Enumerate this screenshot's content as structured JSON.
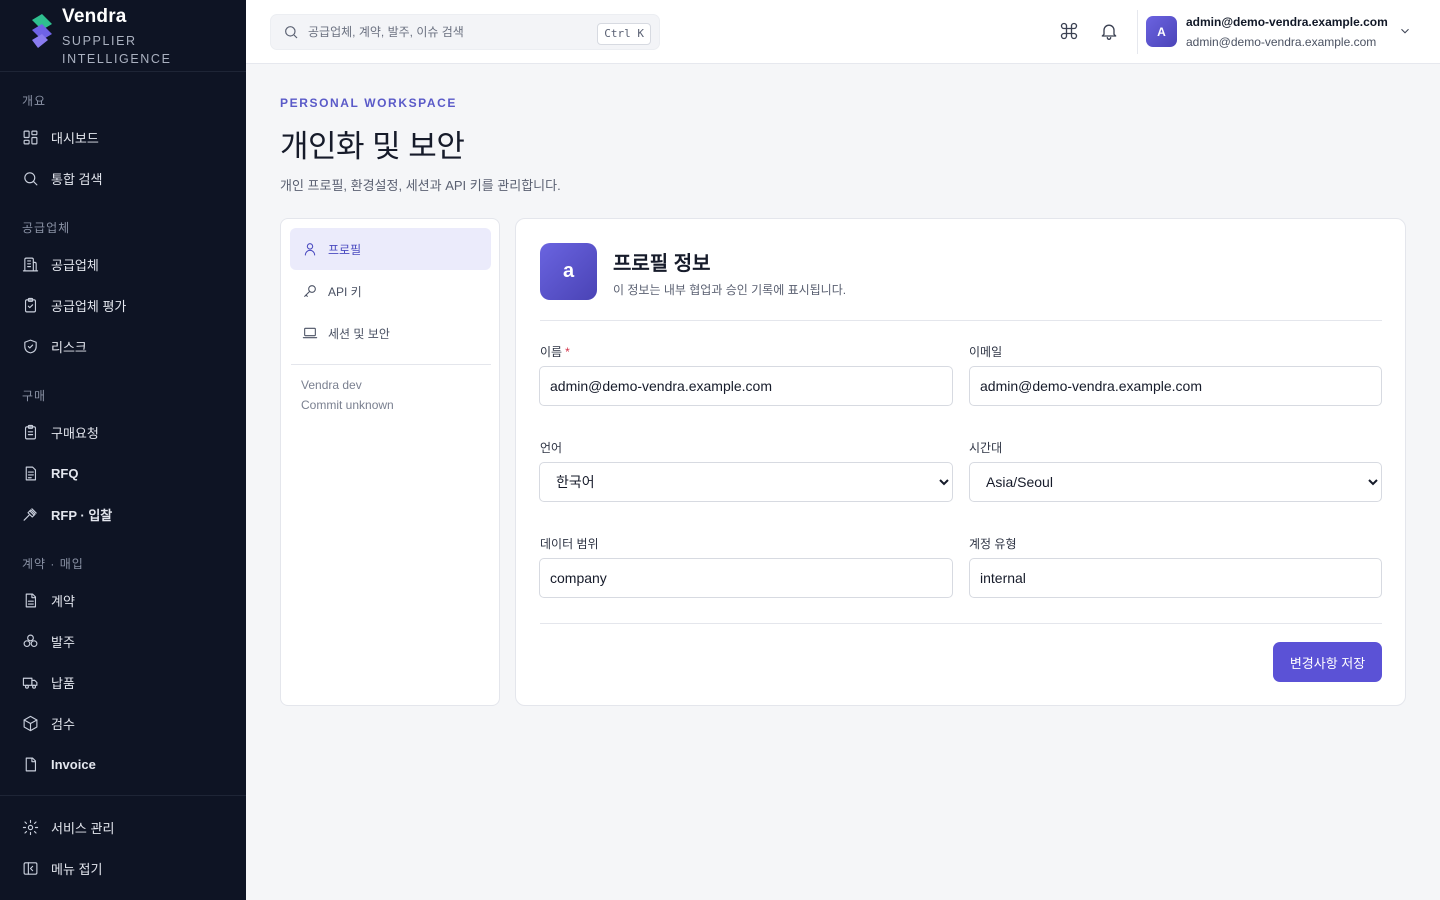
{
  "brand": {
    "name": "Vendra",
    "subtitle": "SUPPLIER INTELLIGENCE"
  },
  "sidebar": {
    "sections": [
      {
        "label": "개요"
      },
      {
        "label": "공급업체"
      },
      {
        "label": "구매"
      },
      {
        "label": "계약 · 매입"
      }
    ],
    "items": [
      {
        "label": "대시보드",
        "icon": "dashboard-icon"
      },
      {
        "label": "통합 검색",
        "icon": "search-icon"
      },
      {
        "label": "공급업체",
        "icon": "building-icon"
      },
      {
        "label": "공급업체 평가",
        "icon": "clipboard-check-icon"
      },
      {
        "label": "리스크",
        "icon": "shield-check-icon"
      },
      {
        "label": "구매요청",
        "icon": "clipboard-list-icon"
      },
      {
        "label": "RFQ",
        "icon": "document-list-icon"
      },
      {
        "label": "RFP · 입찰",
        "icon": "gavel-icon"
      },
      {
        "label": "계약",
        "icon": "document-icon"
      },
      {
        "label": "발주",
        "icon": "boxes-icon"
      },
      {
        "label": "납품",
        "icon": "truck-icon"
      },
      {
        "label": "검수",
        "icon": "package-icon"
      },
      {
        "label": "Invoice",
        "icon": "invoice-icon"
      }
    ],
    "footer": [
      {
        "label": "서비스 관리",
        "icon": "gear-icon"
      },
      {
        "label": "메뉴 접기",
        "icon": "collapse-sidebar-icon"
      }
    ]
  },
  "topbar": {
    "search_placeholder": "공급업체, 계약, 발주, 이슈 검색",
    "search_shortcut": "Ctrl K",
    "user": {
      "initial": "A",
      "name": "admin@demo-vendra.example.com",
      "email": "admin@demo-vendra.example.com"
    }
  },
  "page": {
    "eyebrow": "PERSONAL WORKSPACE",
    "title": "개인화 및 보안",
    "description": "개인 프로필, 환경설정, 세션과 API 키를 관리합니다."
  },
  "settings_nav": {
    "items": [
      {
        "label": "프로필",
        "icon": "user-icon",
        "active": true
      },
      {
        "label": "API 키",
        "icon": "key-icon",
        "active": false
      },
      {
        "label": "세션 및 보안",
        "icon": "laptop-icon",
        "active": false
      }
    ],
    "meta": {
      "version": "Vendra dev",
      "commit": "Commit unknown"
    }
  },
  "profile": {
    "avatar_initial": "a",
    "title": "프로필 정보",
    "subtitle": "이 정보는 내부 협업과 승인 기록에 표시됩니다.",
    "fields": {
      "name": {
        "label": "이름",
        "required_mark": "*",
        "value": "admin@demo-vendra.example.com"
      },
      "email": {
        "label": "이메일",
        "value": "admin@demo-vendra.example.com"
      },
      "language": {
        "label": "언어",
        "value": "한국어"
      },
      "timezone": {
        "label": "시간대",
        "value": "Asia/Seoul"
      },
      "data_scope": {
        "label": "데이터 범위",
        "value": "company"
      },
      "account_type": {
        "label": "계정 유형",
        "value": "internal"
      }
    },
    "save_label": "변경사항 저장"
  },
  "colors": {
    "sidebar_bg": "#0e1424",
    "accent": "#5b52d6",
    "active_nav_bg": "#ebebfb"
  }
}
